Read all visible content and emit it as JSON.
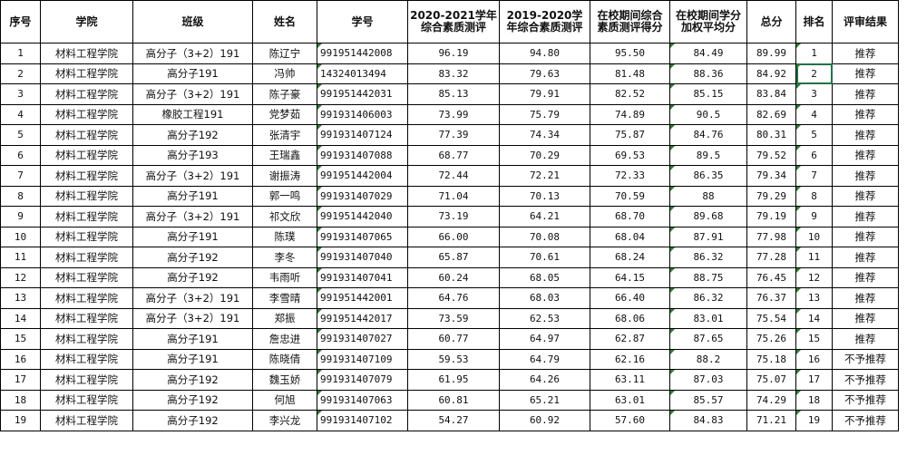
{
  "headers": [
    "序号",
    "学院",
    "班级",
    "姓名",
    "学号",
    "2020-2021学年综合素质测评",
    "2019-2020学年综合素质测评",
    "在校期间综合素质测评得分",
    "在校期间学分加权平均分",
    "总分",
    "排名",
    "评审结果"
  ],
  "rows": [
    [
      "1",
      "材料工程学院",
      "高分子（3+2）191",
      "陈辽宁",
      "991951442008",
      "96.19",
      "94.80",
      "95.50",
      "84.49",
      "89.99",
      "1",
      "推荐"
    ],
    [
      "2",
      "材料工程学院",
      "高分子191",
      "冯帅",
      "14324013494",
      "83.32",
      "79.63",
      "81.48",
      "88.36",
      "84.92",
      "2",
      "推荐"
    ],
    [
      "3",
      "材料工程学院",
      "高分子（3+2）191",
      "陈子豪",
      "991951442031",
      "85.13",
      "79.91",
      "82.52",
      "85.15",
      "83.84",
      "3",
      "推荐"
    ],
    [
      "4",
      "材料工程学院",
      "橡胶工程191",
      "党梦茹",
      "991931406003",
      "73.99",
      "75.79",
      "74.89",
      "90.5",
      "82.69",
      "4",
      "推荐"
    ],
    [
      "5",
      "材料工程学院",
      "高分子192",
      "张清宇",
      "991931407124",
      "77.39",
      "74.34",
      "75.87",
      "84.76",
      "80.31",
      "5",
      "推荐"
    ],
    [
      "6",
      "材料工程学院",
      "高分子193",
      "王瑞鑫",
      "991931407088",
      "68.77",
      "70.29",
      "69.53",
      "89.5",
      "79.52",
      "6",
      "推荐"
    ],
    [
      "7",
      "材料工程学院",
      "高分子（3+2）191",
      "谢振涛",
      "991951442004",
      "72.44",
      "72.21",
      "72.33",
      "86.35",
      "79.34",
      "7",
      "推荐"
    ],
    [
      "8",
      "材料工程学院",
      "高分子191",
      "郭一鸣",
      "991931407029",
      "71.04",
      "70.13",
      "70.59",
      "88",
      "79.29",
      "8",
      "推荐"
    ],
    [
      "9",
      "材料工程学院",
      "高分子（3+2）191",
      "祁文欣",
      "991951442040",
      "73.19",
      "64.21",
      "68.70",
      "89.68",
      "79.19",
      "9",
      "推荐"
    ],
    [
      "10",
      "材料工程学院",
      "高分子191",
      "陈璞",
      "991931407065",
      "66.00",
      "70.08",
      "68.04",
      "87.91",
      "77.98",
      "10",
      "推荐"
    ],
    [
      "11",
      "材料工程学院",
      "高分子192",
      "李冬",
      "991931407040",
      "65.87",
      "70.61",
      "68.24",
      "86.32",
      "77.28",
      "11",
      "推荐"
    ],
    [
      "12",
      "材料工程学院",
      "高分子192",
      "韦雨听",
      "991931407041",
      "60.24",
      "68.05",
      "64.15",
      "88.75",
      "76.45",
      "12",
      "推荐"
    ],
    [
      "13",
      "材料工程学院",
      "高分子（3+2）191",
      "李雪晴",
      "991951442001",
      "64.76",
      "68.03",
      "66.40",
      "86.32",
      "76.37",
      "13",
      "推荐"
    ],
    [
      "14",
      "材料工程学院",
      "高分子（3+2）191",
      "郑振",
      "991951442017",
      "73.59",
      "62.53",
      "68.06",
      "83.01",
      "75.54",
      "14",
      "推荐"
    ],
    [
      "15",
      "材料工程学院",
      "高分子191",
      "詹忠进",
      "991931407027",
      "60.77",
      "64.97",
      "62.87",
      "87.65",
      "75.26",
      "15",
      "推荐"
    ],
    [
      "16",
      "材料工程学院",
      "高分子191",
      "陈晓倩",
      "991931407109",
      "59.53",
      "64.79",
      "62.16",
      "88.2",
      "75.18",
      "16",
      "不予推荐"
    ],
    [
      "17",
      "材料工程学院",
      "高分子192",
      "魏玉娇",
      "991931407079",
      "61.95",
      "64.26",
      "63.11",
      "87.03",
      "75.07",
      "17",
      "不予推荐"
    ],
    [
      "18",
      "材料工程学院",
      "高分子192",
      "何旭",
      "991931407063",
      "60.81",
      "65.21",
      "63.01",
      "85.57",
      "74.29",
      "18",
      "不予推荐"
    ],
    [
      "19",
      "材料工程学院",
      "高分子192",
      "李兴龙",
      "991931407102",
      "54.27",
      "60.92",
      "57.60",
      "84.83",
      "71.21",
      "19",
      "不予推荐"
    ]
  ]
}
